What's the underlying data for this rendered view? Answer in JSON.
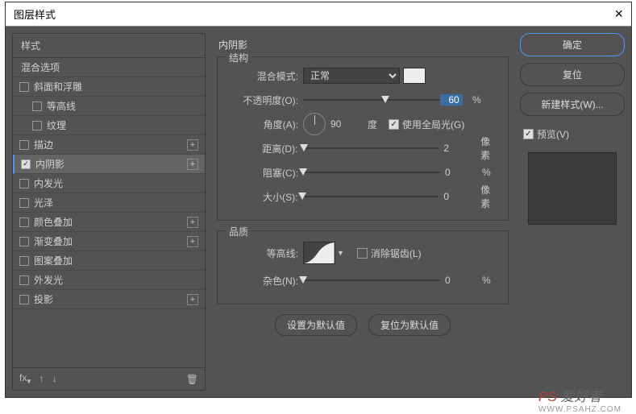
{
  "dialog": {
    "title": "图层样式",
    "close": "×"
  },
  "sidebar": {
    "header": "样式",
    "blending": "混合选项",
    "items": [
      {
        "label": "斜面和浮雕",
        "checked": false,
        "plus": false,
        "indent": false
      },
      {
        "label": "等高线",
        "checked": false,
        "plus": false,
        "indent": true
      },
      {
        "label": "纹理",
        "checked": false,
        "plus": false,
        "indent": true
      },
      {
        "label": "描边",
        "checked": false,
        "plus": true,
        "indent": false
      },
      {
        "label": "内阴影",
        "checked": true,
        "plus": true,
        "indent": false,
        "active": true
      },
      {
        "label": "内发光",
        "checked": false,
        "plus": false,
        "indent": false
      },
      {
        "label": "光泽",
        "checked": false,
        "plus": false,
        "indent": false
      },
      {
        "label": "颜色叠加",
        "checked": false,
        "plus": true,
        "indent": false
      },
      {
        "label": "渐变叠加",
        "checked": false,
        "plus": true,
        "indent": false
      },
      {
        "label": "图案叠加",
        "checked": false,
        "plus": false,
        "indent": false
      },
      {
        "label": "外发光",
        "checked": false,
        "plus": false,
        "indent": false
      },
      {
        "label": "投影",
        "checked": false,
        "plus": true,
        "indent": false
      }
    ],
    "footer": {
      "fx": "fx"
    }
  },
  "panel": {
    "title": "内阴影",
    "structure": {
      "title": "结构",
      "blend_mode_label": "混合模式:",
      "blend_mode_value": "正常",
      "opacity_label": "不透明度(O):",
      "opacity_value": "60",
      "opacity_unit": "%",
      "angle_label": "角度(A):",
      "angle_value": "90",
      "angle_unit": "度",
      "global_light_label": "使用全局光(G)",
      "distance_label": "距离(D):",
      "distance_value": "2",
      "distance_unit": "像素",
      "choke_label": "阻塞(C):",
      "choke_value": "0",
      "choke_unit": "%",
      "size_label": "大小(S):",
      "size_value": "0",
      "size_unit": "像素"
    },
    "quality": {
      "title": "品质",
      "contour_label": "等高线:",
      "antialias_label": "消除锯齿(L)",
      "noise_label": "杂色(N):",
      "noise_value": "0",
      "noise_unit": "%"
    },
    "buttons": {
      "set_default": "设置为默认值",
      "reset_default": "复位为默认值"
    }
  },
  "right": {
    "ok": "确定",
    "cancel": "复位",
    "new_style": "新建样式(W)...",
    "preview": "预览(V)"
  },
  "watermark": {
    "main": "PS 爱好者",
    "sub": "WWW.PSAHZ.COM"
  }
}
